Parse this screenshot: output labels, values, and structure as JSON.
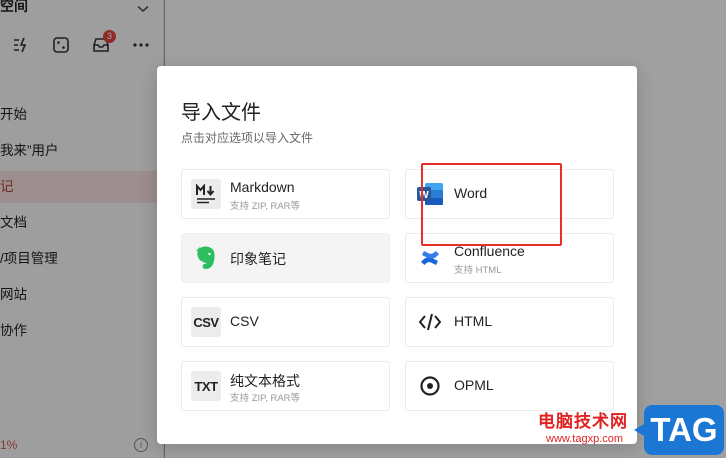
{
  "sidebar": {
    "title": "空间",
    "tools_badge": "3",
    "items": [
      {
        "label": "开始"
      },
      {
        "label": "我来”用户"
      },
      {
        "label": "记"
      },
      {
        "label": "文档"
      },
      {
        "label": "/项目管理"
      },
      {
        "label": "网站"
      },
      {
        "label": "协作"
      }
    ],
    "footer_percent": "1%",
    "footer_info": "i"
  },
  "modal": {
    "title": "导入文件",
    "subtitle": "点击对应选项以导入文件",
    "options": [
      {
        "name": "Markdown",
        "desc": "支持 ZIP, RAR等",
        "icon": "markdown-icon"
      },
      {
        "name": "Word",
        "desc": "",
        "icon": "word-icon"
      },
      {
        "name": "印象笔记",
        "desc": "",
        "icon": "evernote-icon"
      },
      {
        "name": "Confluence",
        "desc": "支持 HTML",
        "icon": "confluence-icon"
      },
      {
        "name": "CSV",
        "desc": "",
        "icon": "csv-icon",
        "icon_text": "CSV"
      },
      {
        "name": "HTML",
        "desc": "",
        "icon": "code-icon"
      },
      {
        "name": "纯文本格式",
        "desc": "支持 ZIP, RAR等",
        "icon": "txt-icon",
        "icon_text": "TXT"
      },
      {
        "name": "OPML",
        "desc": "",
        "icon": "opml-icon"
      }
    ]
  },
  "watermark": {
    "cn": "电脑技术网",
    "url": "www.tagxp.com",
    "tag": "TAG"
  },
  "colors": {
    "accent_red": "#e8302b",
    "word_blue": "#2b5797",
    "evernote_green": "#2dbe60",
    "confluence_blue": "#1868db"
  }
}
